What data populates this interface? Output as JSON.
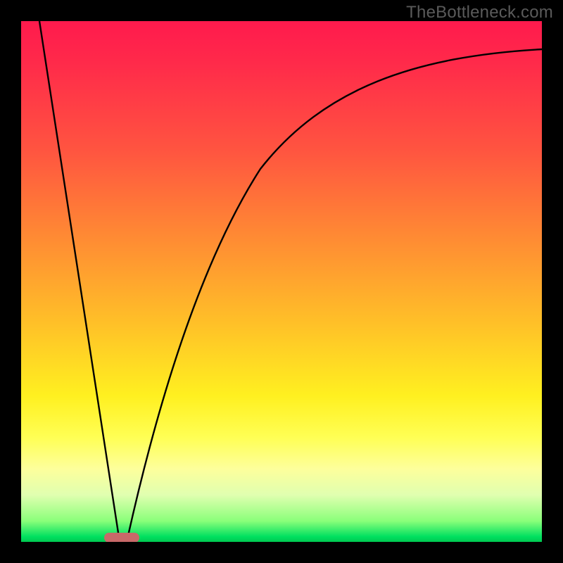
{
  "watermark": "TheBottleneck.com",
  "colors": {
    "frame": "#000000",
    "curve": "#000000",
    "pill": "#c86969"
  },
  "chart_data": {
    "type": "line",
    "title": "",
    "xlabel": "",
    "ylabel": "",
    "xlim": [
      0,
      100
    ],
    "ylim": [
      0,
      100
    ],
    "grid": false,
    "legend": false,
    "annotations": [
      {
        "name": "optimal-marker",
        "x": 19,
        "y": 0,
        "width_pct": 6
      }
    ],
    "series": [
      {
        "name": "linear-descent",
        "x": [
          3.5,
          19
        ],
        "y": [
          100,
          0
        ]
      },
      {
        "name": "asymptotic-ascent",
        "x": [
          19,
          23,
          27,
          32,
          38,
          45,
          53,
          62,
          72,
          83,
          100
        ],
        "y": [
          0,
          18,
          33,
          47,
          58,
          68,
          76,
          82,
          86.5,
          89.5,
          92
        ]
      }
    ],
    "background_gradient": {
      "orientation": "vertical",
      "stops": [
        {
          "pos": 0.0,
          "color": "#ff1a4d"
        },
        {
          "pos": 0.25,
          "color": "#ff5540"
        },
        {
          "pos": 0.58,
          "color": "#ffc028"
        },
        {
          "pos": 0.8,
          "color": "#ffff55"
        },
        {
          "pos": 0.96,
          "color": "#8aff7a"
        },
        {
          "pos": 1.0,
          "color": "#00c850"
        }
      ]
    }
  }
}
